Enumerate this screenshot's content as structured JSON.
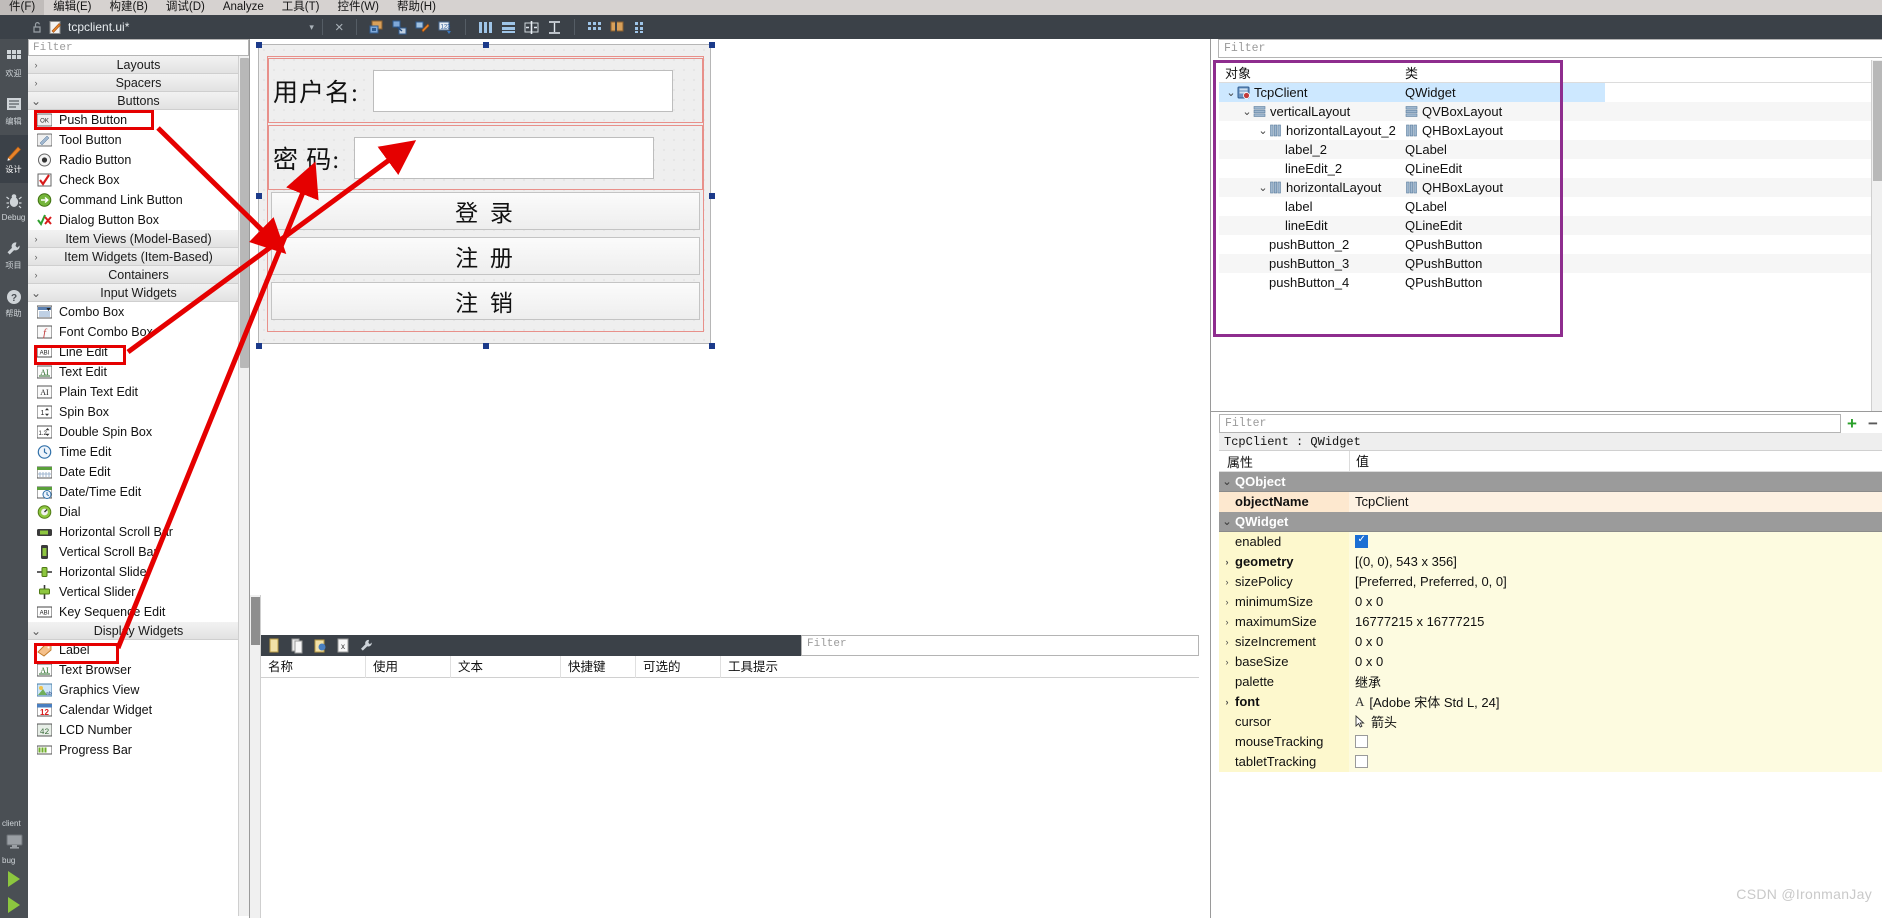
{
  "menubar": {
    "items": [
      "件(F)",
      "编辑(E)",
      "构建(B)",
      "调试(D)",
      "Analyze",
      "工具(T)",
      "控件(W)",
      "帮助(H)"
    ]
  },
  "doc_toolbar": {
    "lock_icon": "unlock-icon",
    "file_icon": "ui-file-icon",
    "filename": "tcpclient.ui*",
    "dropdown_arrow": "▾",
    "close_icon": "×",
    "tools": [
      "edit-widgets-icon",
      "edit-signals-slots-icon",
      "edit-buddies-icon",
      "edit-tab-order-icon",
      "layout-horizontally-icon",
      "layout-vertically-icon",
      "layout-splitter-horizontal-icon",
      "layout-splitter-vertical-icon",
      "layout-grid-icon",
      "break-layout-icon",
      "adjust-size-icon"
    ]
  },
  "modebar": {
    "items": [
      {
        "label": "欢迎",
        "icon": "welcome-grid-icon",
        "active": false
      },
      {
        "label": "编辑",
        "icon": "edit-document-icon",
        "active": false
      },
      {
        "label": "设计",
        "icon": "design-pencil-icon",
        "active": true
      },
      {
        "label": "Debug",
        "icon": "debug-bug-icon",
        "active": false
      },
      {
        "label": "项目",
        "icon": "projects-wrench-icon",
        "active": false
      },
      {
        "label": "帮助",
        "icon": "help-question-icon",
        "active": false
      }
    ],
    "kit": {
      "project": "client",
      "config": "bug",
      "monitor_icon": "monitor-icon",
      "run_icon": "run-triangle-icon"
    }
  },
  "widgetbox": {
    "filter_placeholder": "Filter",
    "groups": [
      {
        "label": "Layouts",
        "expanded": false,
        "items": []
      },
      {
        "label": "Spacers",
        "expanded": false,
        "items": []
      },
      {
        "label": "Buttons",
        "expanded": true,
        "items": [
          {
            "label": "Push Button",
            "icon": "push-button-icon",
            "highlighted": true
          },
          {
            "label": "Tool Button",
            "icon": "tool-button-icon",
            "highlighted": false
          },
          {
            "label": "Radio Button",
            "icon": "radio-button-icon",
            "highlighted": false
          },
          {
            "label": "Check Box",
            "icon": "check-box-icon",
            "highlighted": false
          },
          {
            "label": "Command Link Button",
            "icon": "command-link-button-icon",
            "highlighted": false
          },
          {
            "label": "Dialog Button Box",
            "icon": "dialog-button-box-icon",
            "highlighted": false
          }
        ]
      },
      {
        "label": "Item Views (Model-Based)",
        "expanded": false,
        "items": []
      },
      {
        "label": "Item Widgets (Item-Based)",
        "expanded": false,
        "items": []
      },
      {
        "label": "Containers",
        "expanded": false,
        "items": []
      },
      {
        "label": "Input Widgets",
        "expanded": true,
        "items": [
          {
            "label": "Combo Box",
            "icon": "combo-box-icon",
            "highlighted": false
          },
          {
            "label": "Font Combo Box",
            "icon": "font-combo-box-icon",
            "highlighted": false
          },
          {
            "label": "Line Edit",
            "icon": "line-edit-icon",
            "highlighted": true
          },
          {
            "label": "Text Edit",
            "icon": "text-edit-icon",
            "highlighted": false
          },
          {
            "label": "Plain Text Edit",
            "icon": "plain-text-edit-icon",
            "highlighted": false
          },
          {
            "label": "Spin Box",
            "icon": "spin-box-icon",
            "highlighted": false
          },
          {
            "label": "Double Spin Box",
            "icon": "double-spin-box-icon",
            "highlighted": false
          },
          {
            "label": "Time Edit",
            "icon": "time-edit-icon",
            "highlighted": false
          },
          {
            "label": "Date Edit",
            "icon": "date-edit-icon",
            "highlighted": false
          },
          {
            "label": "Date/Time Edit",
            "icon": "date-time-edit-icon",
            "highlighted": false
          },
          {
            "label": "Dial",
            "icon": "dial-icon",
            "highlighted": false
          },
          {
            "label": "Horizontal Scroll Bar",
            "icon": "horizontal-scroll-bar-icon",
            "highlighted": false
          },
          {
            "label": "Vertical Scroll Bar",
            "icon": "vertical-scroll-bar-icon",
            "highlighted": false
          },
          {
            "label": "Horizontal Slider",
            "icon": "horizontal-slider-icon",
            "highlighted": false
          },
          {
            "label": "Vertical Slider",
            "icon": "vertical-slider-icon",
            "highlighted": false
          },
          {
            "label": "Key Sequence Edit",
            "icon": "key-sequence-edit-icon",
            "highlighted": false
          }
        ]
      },
      {
        "label": "Display Widgets",
        "expanded": true,
        "items": [
          {
            "label": "Label",
            "icon": "label-icon",
            "highlighted": true
          },
          {
            "label": "Text Browser",
            "icon": "text-browser-icon",
            "highlighted": false
          },
          {
            "label": "Graphics View",
            "icon": "graphics-view-icon",
            "highlighted": false
          },
          {
            "label": "Calendar Widget",
            "icon": "calendar-widget-icon",
            "highlighted": false
          },
          {
            "label": "LCD Number",
            "icon": "lcd-number-icon",
            "highlighted": false
          },
          {
            "label": "Progress Bar",
            "icon": "progress-bar-icon",
            "highlighted": false
          }
        ]
      }
    ]
  },
  "form": {
    "rows": [
      {
        "label": "用户名:",
        "edit_value": ""
      },
      {
        "label": "密    码:",
        "edit_value": ""
      }
    ],
    "buttons": [
      "登 录",
      "注 册",
      "注 销"
    ]
  },
  "action_editor": {
    "toolbar_icons": [
      "new-action-icon",
      "copy-action-icon",
      "edit-action-icon",
      "delete-action-icon",
      "configure-icon"
    ],
    "filter_placeholder": "Filter",
    "columns": [
      "名称",
      "使用",
      "文本",
      "快捷键",
      "可选的",
      "工具提示"
    ],
    "rows": []
  },
  "object_inspector": {
    "filter_placeholder": "Filter",
    "columns": [
      "对象",
      "类"
    ],
    "rows": [
      {
        "indent": 0,
        "expander": "v",
        "icon": "widget-icon",
        "name": "TcpClient",
        "class": "QWidget",
        "class_icon": "",
        "selected": true
      },
      {
        "indent": 1,
        "expander": "v",
        "icon": "vbox-icon",
        "name": "verticalLayout",
        "class": "QVBoxLayout",
        "class_icon": "vbox-icon",
        "selected": false
      },
      {
        "indent": 2,
        "expander": "v",
        "icon": "hbox-icon",
        "name": "horizontalLayout_2",
        "class": "QHBoxLayout",
        "class_icon": "hbox-icon",
        "selected": false
      },
      {
        "indent": 3,
        "expander": "",
        "icon": "",
        "name": "label_2",
        "class": "QLabel",
        "class_icon": "",
        "selected": false
      },
      {
        "indent": 3,
        "expander": "",
        "icon": "",
        "name": "lineEdit_2",
        "class": "QLineEdit",
        "class_icon": "",
        "selected": false
      },
      {
        "indent": 2,
        "expander": "v",
        "icon": "hbox-icon",
        "name": "horizontalLayout",
        "class": "QHBoxLayout",
        "class_icon": "hbox-icon",
        "selected": false
      },
      {
        "indent": 3,
        "expander": "",
        "icon": "",
        "name": "label",
        "class": "QLabel",
        "class_icon": "",
        "selected": false
      },
      {
        "indent": 3,
        "expander": "",
        "icon": "",
        "name": "lineEdit",
        "class": "QLineEdit",
        "class_icon": "",
        "selected": false
      },
      {
        "indent": 2,
        "expander": "",
        "icon": "",
        "name": "pushButton_2",
        "class": "QPushButton",
        "class_icon": "",
        "selected": false
      },
      {
        "indent": 2,
        "expander": "",
        "icon": "",
        "name": "pushButton_3",
        "class": "QPushButton",
        "class_icon": "",
        "selected": false
      },
      {
        "indent": 2,
        "expander": "",
        "icon": "",
        "name": "pushButton_4",
        "class": "QPushButton",
        "class_icon": "",
        "selected": false
      }
    ]
  },
  "property_editor": {
    "filter_placeholder": "Filter",
    "add_label": "+",
    "remove_label": "−",
    "title": "TcpClient : QWidget",
    "columns": [
      "属性",
      "值"
    ],
    "rows": [
      {
        "kind": "group",
        "key": "QObject",
        "value": "",
        "expander": "v",
        "bold": true
      },
      {
        "kind": "peach",
        "key": "objectName",
        "value": "TcpClient",
        "expander": "",
        "bold": true
      },
      {
        "kind": "group",
        "key": "QWidget",
        "value": "",
        "expander": "v",
        "bold": true
      },
      {
        "kind": "yellow",
        "key": "enabled",
        "value": "",
        "expander": "",
        "bold": false,
        "checkbox": true,
        "checked": true
      },
      {
        "kind": "yellow",
        "key": "geometry",
        "value": "[(0, 0), 543 x 356]",
        "expander": ">",
        "bold": true
      },
      {
        "kind": "yellow",
        "key": "sizePolicy",
        "value": "[Preferred, Preferred, 0, 0]",
        "expander": ">",
        "bold": false
      },
      {
        "kind": "yellow",
        "key": "minimumSize",
        "value": "0 x 0",
        "expander": ">",
        "bold": false
      },
      {
        "kind": "yellow",
        "key": "maximumSize",
        "value": "16777215 x 16777215",
        "expander": ">",
        "bold": false
      },
      {
        "kind": "yellow",
        "key": "sizeIncrement",
        "value": "0 x 0",
        "expander": ">",
        "bold": false
      },
      {
        "kind": "yellow",
        "key": "baseSize",
        "value": "0 x 0",
        "expander": ">",
        "bold": false
      },
      {
        "kind": "yellow",
        "key": "palette",
        "value": "继承",
        "expander": "",
        "bold": false
      },
      {
        "kind": "yellow",
        "key": "font",
        "value": "[Adobe 宋体 Std L, 24]",
        "expander": ">",
        "bold": true,
        "prefix_icon": "font-A-icon"
      },
      {
        "kind": "yellow",
        "key": "cursor",
        "value": "箭头",
        "expander": "",
        "bold": false,
        "prefix_icon": "arrow-cursor-icon"
      },
      {
        "kind": "yellow",
        "key": "mouseTracking",
        "value": "",
        "expander": "",
        "bold": false,
        "checkbox": true,
        "checked": false
      },
      {
        "kind": "yellow",
        "key": "tabletTracking",
        "value": "",
        "expander": "",
        "bold": false,
        "checkbox": true,
        "checked": false
      }
    ]
  },
  "annotations": {
    "highlight_color": "#e50000",
    "tree_box_color": "#8e2d8e",
    "arrow_color": "#e50000"
  },
  "watermark": "CSDN @IronmanJay"
}
